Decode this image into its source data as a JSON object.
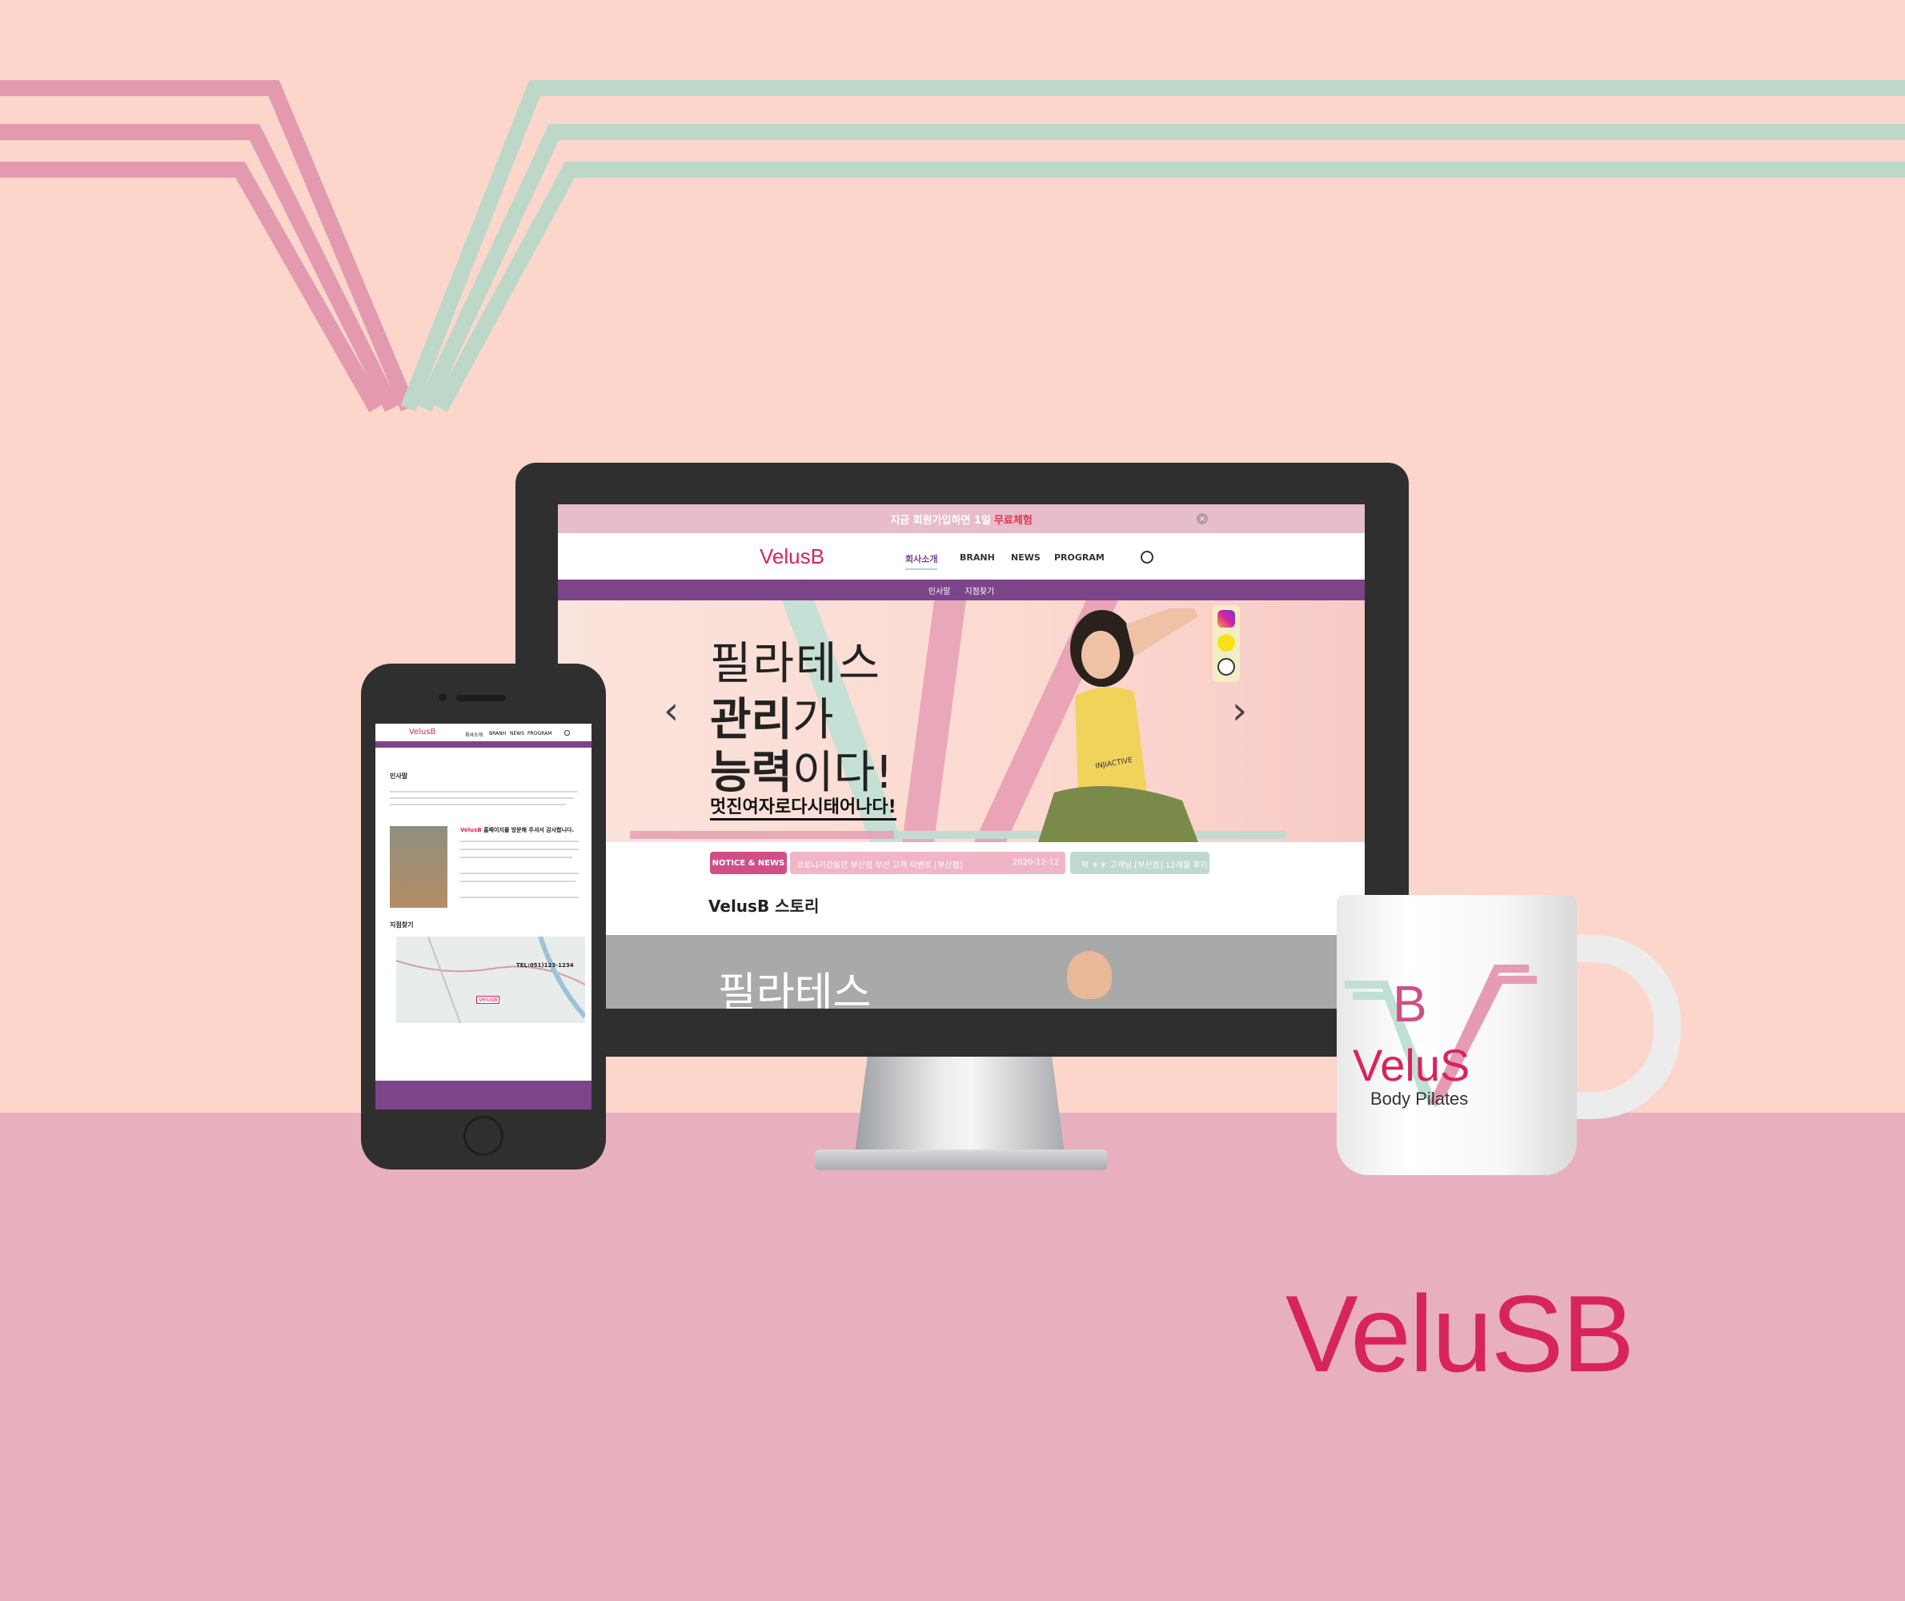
{
  "site": {
    "top_banner": {
      "prefix": "지금",
      "middle": "회원가입",
      "middle2": "하면 1일",
      "highlight": "무료체험"
    },
    "logo": "VelusB",
    "nav": [
      "회사소개",
      "BRANH",
      "NEWS",
      "PROGRAM"
    ],
    "subnav": [
      "인사말",
      "지점찾기"
    ],
    "hero": {
      "line1": "필라테스",
      "line2_bold": "관리",
      "line2_rest": "가",
      "line3_bold": "능력",
      "line3_rest": "이다!",
      "sub": "멋진여자로다시태어나다!",
      "shirt_text": "INJIACTIVE"
    },
    "notice": {
      "badge": "NOTICE & NEWS",
      "item1": "코로나기간동안 부산점 부산 고객 이벤트 [부산점]",
      "item1_date": "2020-12-12",
      "item2": "박 ＊＊ 고객님 [부산점] 12개월 후기"
    },
    "story_title": "VelusB 스토리",
    "story_image_text": "필라테스"
  },
  "phone": {
    "nav_logo": "VelusB",
    "nav": [
      "회사소개",
      "BRANH",
      "NEWS",
      "PROGRAM"
    ],
    "greeting_title": "인사말",
    "welcome": "홈페이지를 방문해 주셔서 감사합니다.",
    "welcome_brand": "VelusB",
    "map_title": "지점찾기",
    "map_tel": "TEL:051)123-1234",
    "map_marker": "VelusB"
  },
  "mug": {
    "brand": "VeluS",
    "subtitle": "Body Pilates",
    "monogram": "B"
  },
  "big_logo": "VeluSB",
  "colors": {
    "bg": "#fdd6cb",
    "floor": "#e8b0bf",
    "pink": "#e39aaf",
    "mint": "#bdd8c9",
    "purple": "#7c4589",
    "brand": "#d7245d"
  }
}
